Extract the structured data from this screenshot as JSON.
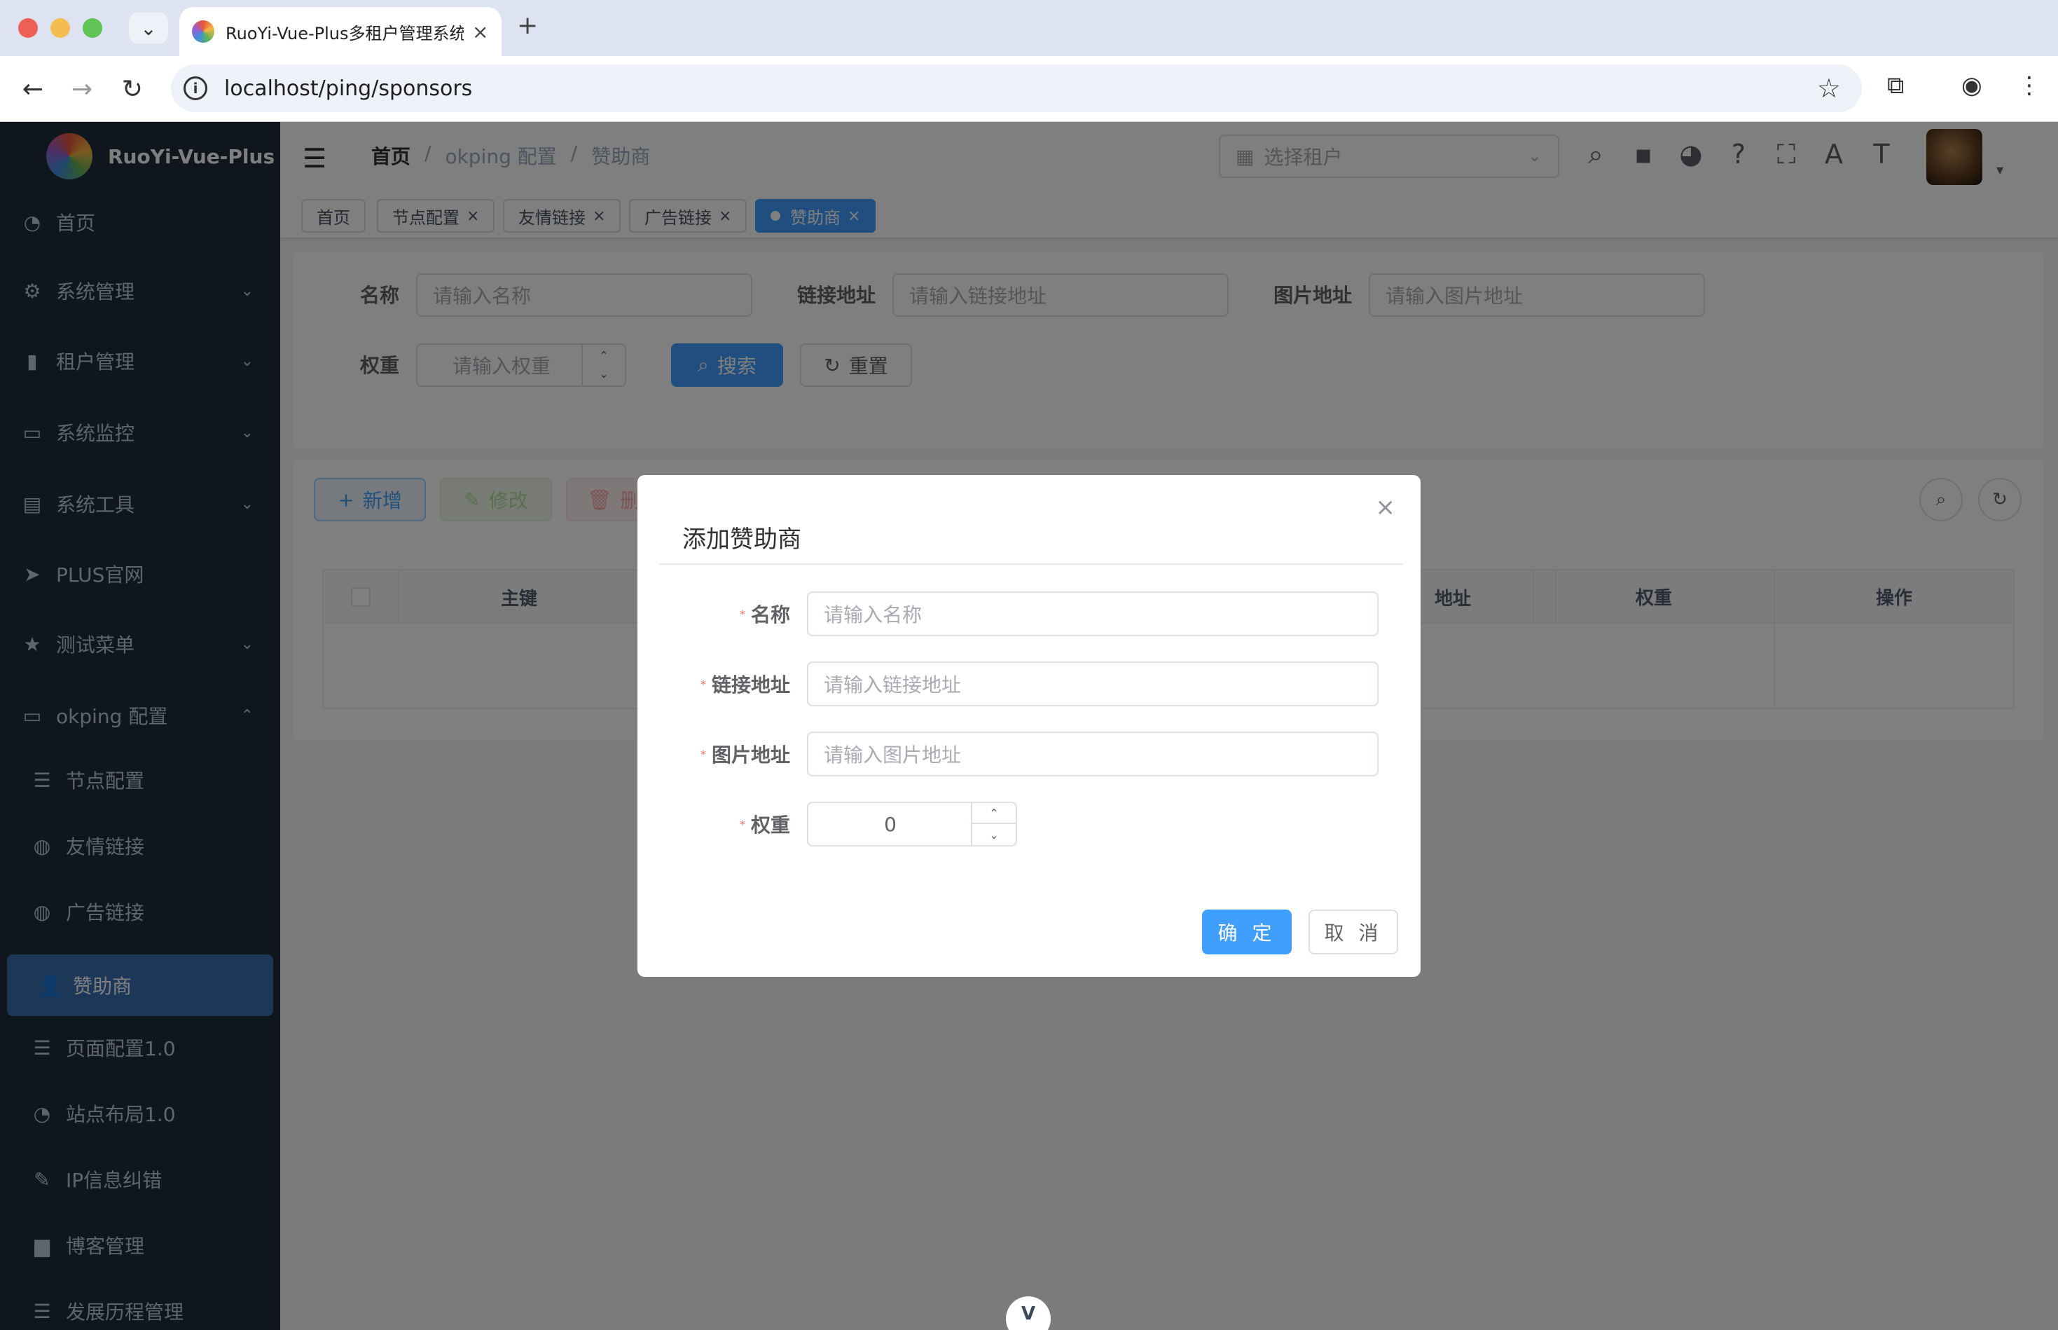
{
  "browser": {
    "tab_title": "RuoYi-Vue-Plus多租户管理系统",
    "url": "localhost/ping/sponsors"
  },
  "sidebar": {
    "logo_text": "RuoYi-Vue-Plus",
    "items": [
      {
        "label": "首页",
        "icon": "dashboard-icon"
      },
      {
        "label": "系统管理",
        "icon": "gear-icon"
      },
      {
        "label": "租户管理",
        "icon": "chart-icon"
      },
      {
        "label": "系统监控",
        "icon": "monitor-icon"
      },
      {
        "label": "系统工具",
        "icon": "toolbox-icon"
      },
      {
        "label": "PLUS官网",
        "icon": "send-icon"
      },
      {
        "label": "测试菜单",
        "icon": "star-icon"
      },
      {
        "label": "okping 配置",
        "icon": "monitor-icon"
      }
    ],
    "subitems": [
      {
        "label": "节点配置",
        "icon": "list-icon"
      },
      {
        "label": "友情链接",
        "icon": "globe-icon"
      },
      {
        "label": "广告链接",
        "icon": "globe-icon"
      },
      {
        "label": "赞助商",
        "icon": "user-icon"
      },
      {
        "label": "页面配置1.0",
        "icon": "list-icon"
      },
      {
        "label": "站点布局1.0",
        "icon": "dashboard-icon"
      },
      {
        "label": "IP信息纠错",
        "icon": "edit-icon"
      },
      {
        "label": "博客管理",
        "icon": "clapper-icon"
      },
      {
        "label": "发展历程管理",
        "icon": "list-icon"
      }
    ]
  },
  "navbar": {
    "breadcrumb": [
      "首页",
      "okping 配置",
      "赞助商"
    ],
    "tenant_placeholder": "选择租户"
  },
  "tags": [
    "首页",
    "节点配置",
    "友情链接",
    "广告链接",
    "赞助商"
  ],
  "search_form": {
    "name_label": "名称",
    "name_placeholder": "请输入名称",
    "link_label": "链接地址",
    "link_placeholder": "请输入链接地址",
    "image_label": "图片地址",
    "image_placeholder": "请输入图片地址",
    "weight_label": "权重",
    "weight_placeholder": "请输入权重",
    "search_button": "搜索",
    "reset_button": "重置"
  },
  "toolbar": {
    "add": "新增",
    "edit": "修改",
    "delete": "删"
  },
  "table": {
    "columns": [
      "主键",
      "地址",
      "权重",
      "操作"
    ]
  },
  "dialog": {
    "title": "添加赞助商",
    "name_label": "名称",
    "name_placeholder": "请输入名称",
    "link_label": "链接地址",
    "link_placeholder": "请输入链接地址",
    "image_label": "图片地址",
    "image_placeholder": "请输入图片地址",
    "weight_label": "权重",
    "weight_value": "0",
    "ok_button": "确 定",
    "cancel_button": "取 消"
  },
  "colors": {
    "primary": "#409eff",
    "sidebar_bg": "#1f2d3d",
    "sidebar_active": "#3a6fb0"
  }
}
